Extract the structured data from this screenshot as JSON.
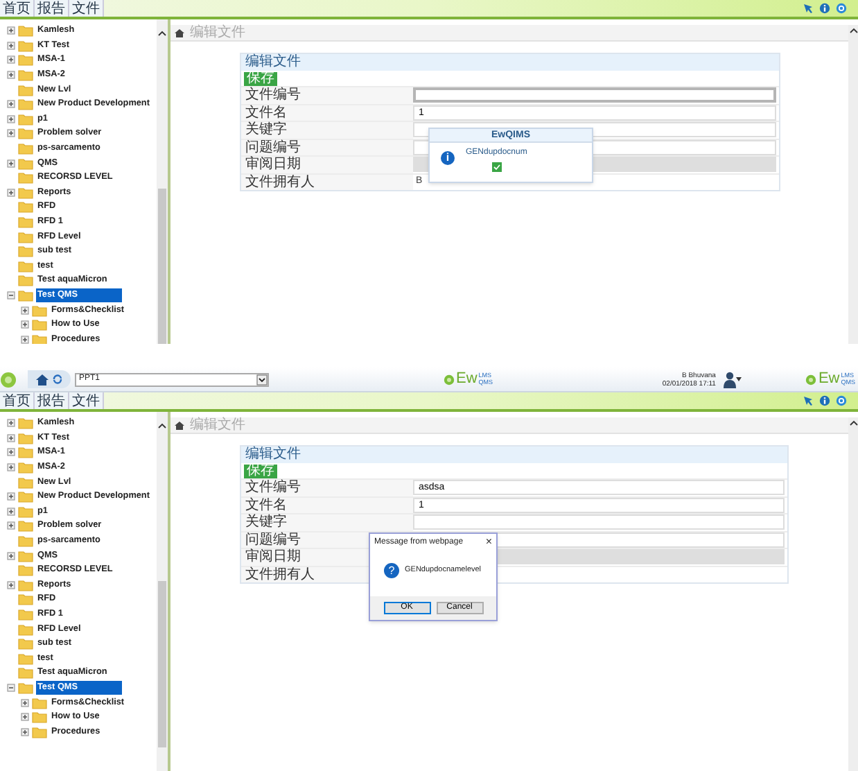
{
  "top_screen": {
    "menu": [
      {
        "label": "首页"
      },
      {
        "label": "报告"
      },
      {
        "label": "文件"
      }
    ],
    "tree": [
      {
        "label": "Kamlesh",
        "kind": "folder",
        "expanded": false,
        "selected": false
      },
      {
        "label": "KT Test",
        "kind": "folder",
        "expanded": false,
        "selected": false
      },
      {
        "label": "MSA-1",
        "kind": "folder",
        "expanded": false,
        "selected": false
      },
      {
        "label": "MSA-2",
        "kind": "folder",
        "expanded": false,
        "selected": false
      },
      {
        "label": "New Lvl",
        "kind": "leaf",
        "selected": false
      },
      {
        "label": "New Product Development",
        "kind": "folder",
        "expanded": false,
        "selected": false
      },
      {
        "label": "p1",
        "kind": "folder",
        "expanded": false,
        "selected": false
      },
      {
        "label": "Problem solver",
        "kind": "folder",
        "expanded": false,
        "selected": false
      },
      {
        "label": "ps-sarcamento",
        "kind": "leaf",
        "selected": false
      },
      {
        "label": "QMS",
        "kind": "folder",
        "expanded": false,
        "selected": false
      },
      {
        "label": "RECORSD LEVEL",
        "kind": "leaf",
        "selected": false
      },
      {
        "label": "Reports",
        "kind": "folder",
        "expanded": false,
        "selected": false
      },
      {
        "label": "RFD",
        "kind": "leaf",
        "selected": false
      },
      {
        "label": "RFD 1",
        "kind": "leaf",
        "selected": false
      },
      {
        "label": "RFD Level",
        "kind": "leaf",
        "selected": false
      },
      {
        "label": "sub test",
        "kind": "leaf",
        "selected": false
      },
      {
        "label": "test",
        "kind": "leaf",
        "selected": false
      },
      {
        "label": "Test aquaMicron",
        "kind": "leaf",
        "selected": false
      },
      {
        "label": "Test QMS",
        "kind": "folder",
        "expanded": true,
        "selected": true,
        "children": [
          {
            "label": "Forms&Checklist",
            "kind": "folder",
            "expanded": false,
            "selected": false
          },
          {
            "label": "How to Use",
            "kind": "folder",
            "expanded": false,
            "selected": false
          },
          {
            "label": "Procedures",
            "kind": "folder",
            "expanded": false,
            "selected": false
          }
        ]
      }
    ],
    "breadcrumb": "编辑文件",
    "form": {
      "title": "编辑文件",
      "save_button": "保存",
      "fields": [
        {
          "label": "文件编号",
          "kind": "input",
          "focused": true
        },
        {
          "label": "文件名",
          "kind": "input",
          "value": "1",
          "focused": false
        },
        {
          "label": "关键字",
          "kind": "input",
          "focused": false
        },
        {
          "label": "问题编号",
          "kind": "input",
          "focused": false
        },
        {
          "label": "审阅日期",
          "kind": "readonly"
        },
        {
          "label": "文件拥有人",
          "kind": "text",
          "value": "B"
        }
      ]
    },
    "popup": {
      "kind": "info",
      "title": "EwQIMS",
      "icon_glyph": "i",
      "message": "GENdupdocnum"
    }
  },
  "app_header": {
    "project_select": "PPT1",
    "logo": {
      "main": "Ew",
      "top": "LMS",
      "bottom": "QMS"
    },
    "user_name": "B Bhuvana",
    "date_time": "02/01/2018 17:11",
    "corner_logo": {
      "main": "Ew",
      "top": "LMS",
      "bottom": "QMS"
    }
  },
  "bottom_screen": {
    "menu": [
      {
        "label": "首页"
      },
      {
        "label": "报告"
      },
      {
        "label": "文件"
      }
    ],
    "tree": [
      {
        "label": "Kamlesh",
        "kind": "folder",
        "expanded": false,
        "selected": false
      },
      {
        "label": "KT Test",
        "kind": "folder",
        "expanded": false,
        "selected": false
      },
      {
        "label": "MSA-1",
        "kind": "folder",
        "expanded": false,
        "selected": false
      },
      {
        "label": "MSA-2",
        "kind": "folder",
        "expanded": false,
        "selected": false
      },
      {
        "label": "New Lvl",
        "kind": "leaf",
        "selected": false
      },
      {
        "label": "New Product Development",
        "kind": "folder",
        "expanded": false,
        "selected": false
      },
      {
        "label": "p1",
        "kind": "folder",
        "expanded": false,
        "selected": false
      },
      {
        "label": "Problem solver",
        "kind": "folder",
        "expanded": false,
        "selected": false
      },
      {
        "label": "ps-sarcamento",
        "kind": "leaf",
        "selected": false
      },
      {
        "label": "QMS",
        "kind": "folder",
        "expanded": false,
        "selected": false
      },
      {
        "label": "RECORSD LEVEL",
        "kind": "leaf",
        "selected": false
      },
      {
        "label": "Reports",
        "kind": "folder",
        "expanded": false,
        "selected": false
      },
      {
        "label": "RFD",
        "kind": "leaf",
        "selected": false
      },
      {
        "label": "RFD 1",
        "kind": "leaf",
        "selected": false
      },
      {
        "label": "RFD Level",
        "kind": "leaf",
        "selected": false
      },
      {
        "label": "sub test",
        "kind": "leaf",
        "selected": false
      },
      {
        "label": "test",
        "kind": "leaf",
        "selected": false
      },
      {
        "label": "Test aquaMicron",
        "kind": "leaf",
        "selected": false
      },
      {
        "label": "Test QMS",
        "kind": "folder",
        "expanded": true,
        "selected": true,
        "children": [
          {
            "label": "Forms&Checklist",
            "kind": "folder",
            "expanded": false,
            "selected": false
          },
          {
            "label": "How to Use",
            "kind": "folder",
            "expanded": false,
            "selected": false
          },
          {
            "label": "Procedures",
            "kind": "folder",
            "expanded": false,
            "selected": false
          }
        ]
      }
    ],
    "breadcrumb": "编辑文件",
    "form": {
      "title": "编辑文件",
      "save_button": "保存",
      "fields": [
        {
          "label": "文件编号",
          "kind": "input",
          "value": "asdsa",
          "focused": false
        },
        {
          "label": "文件名",
          "kind": "input",
          "value": "1",
          "focused": false
        },
        {
          "label": "关键字",
          "kind": "input",
          "focused": false
        },
        {
          "label": "问题编号",
          "kind": "input",
          "focused": false
        },
        {
          "label": "审阅日期",
          "kind": "readonly"
        },
        {
          "label": "文件拥有人",
          "kind": "text"
        }
      ]
    },
    "popup": {
      "kind": "dialog",
      "title": "Message from webpage",
      "close": "×",
      "icon_glyph": "?",
      "message": "GENdupdocnamelevel",
      "buttons": [
        {
          "label": "OK",
          "selected": true
        },
        {
          "label": "Cancel",
          "selected": false
        }
      ]
    }
  }
}
